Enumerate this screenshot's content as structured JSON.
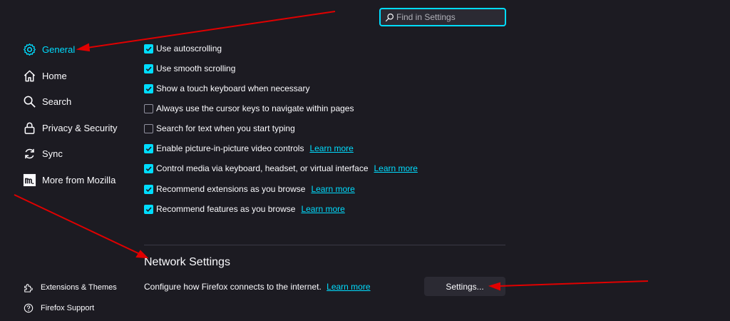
{
  "search": {
    "placeholder": "Find in Settings"
  },
  "sidebar": {
    "items": [
      {
        "label": "General",
        "icon": "gear-icon",
        "active": true
      },
      {
        "label": "Home",
        "icon": "home-icon"
      },
      {
        "label": "Search",
        "icon": "search-icon"
      },
      {
        "label": "Privacy & Security",
        "icon": "lock-icon"
      },
      {
        "label": "Sync",
        "icon": "sync-icon"
      },
      {
        "label": "More from Mozilla",
        "icon": "mozilla-icon"
      }
    ],
    "footer": [
      {
        "label": "Extensions & Themes",
        "icon": "puzzle-icon"
      },
      {
        "label": "Firefox Support",
        "icon": "help-icon"
      }
    ]
  },
  "options": [
    {
      "label": "Use autoscrolling",
      "checked": true
    },
    {
      "label": "Use smooth scrolling",
      "checked": true
    },
    {
      "label": "Show a touch keyboard when necessary",
      "checked": true
    },
    {
      "label": "Always use the cursor keys to navigate within pages",
      "checked": false
    },
    {
      "label": "Search for text when you start typing",
      "checked": false
    },
    {
      "label": "Enable picture-in-picture video controls",
      "checked": true,
      "link": "Learn more"
    },
    {
      "label": "Control media via keyboard, headset, or virtual interface",
      "checked": true,
      "link": "Learn more"
    },
    {
      "label": "Recommend extensions as you browse",
      "checked": true,
      "link": "Learn more"
    },
    {
      "label": "Recommend features as you browse",
      "checked": true,
      "link": "Learn more"
    }
  ],
  "network": {
    "title": "Network Settings",
    "description": "Configure how Firefox connects to the internet.",
    "link": "Learn more",
    "button": "Settings..."
  },
  "colors": {
    "accent": "#00ddff",
    "background": "#1c1b22",
    "annotation": "#e00000"
  }
}
